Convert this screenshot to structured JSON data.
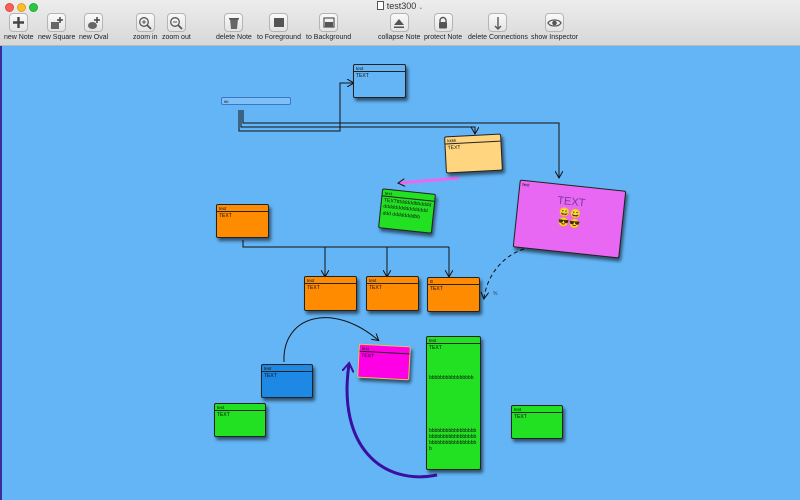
{
  "window": {
    "title": "test300",
    "doc_icon": "document-icon"
  },
  "toolbar": {
    "items": [
      {
        "label": "new Note",
        "icon": "plus-icon"
      },
      {
        "label": "new Square",
        "icon": "new-square-icon"
      },
      {
        "label": "new Oval",
        "icon": "new-oval-icon"
      },
      {
        "label": "zoom in",
        "icon": "zoom-in-icon"
      },
      {
        "label": "zoom out",
        "icon": "zoom-out-icon"
      },
      {
        "label": "delete Note",
        "icon": "trash-icon"
      },
      {
        "label": "to Foreground",
        "icon": "to-foreground-icon"
      },
      {
        "label": "to Background",
        "icon": "to-background-icon"
      },
      {
        "label": "collapse Note",
        "icon": "collapse-icon"
      },
      {
        "label": "protect Note",
        "icon": "lock-icon"
      },
      {
        "label": "delete Connections",
        "icon": "delete-connections-icon"
      },
      {
        "label": "show Inspector",
        "icon": "eye-icon"
      }
    ]
  },
  "canvas": {
    "background": "#64b5f6",
    "search_field": {
      "value": "",
      "placeholder": "tttt"
    },
    "stray_label": "%",
    "notes": {
      "top_white": {
        "title": "text",
        "body": "TEXT",
        "color": "#64b5f6"
      },
      "yellow": {
        "title": "kkkk",
        "body": "TEXT",
        "color": "#ffd580"
      },
      "green_rotated": {
        "title": "text",
        "body": "TEXTtttdddddbbdddd dddddddddddddddd ddd ddddddddbb",
        "color": "#22e022"
      },
      "pink_large": {
        "title": "text",
        "body": "TEXT",
        "color": "#e868f4",
        "emoji_top": "😀😀",
        "emoji_bottom": "😎😎"
      },
      "orange_left": {
        "title": "text",
        "body": "TEXT",
        "color": "#ff8c00"
      },
      "orange_a": {
        "title": "text",
        "body": "TEXT",
        "color": "#ff8c00"
      },
      "orange_b": {
        "title": "text",
        "body": "TEXT",
        "color": "#ff8c00"
      },
      "orange_c": {
        "title": "B",
        "body": "TEXT",
        "color": "#ff8c00"
      },
      "magenta": {
        "title": "text",
        "body": "TEXT",
        "color": "#ff00e6"
      },
      "blue": {
        "title": "text",
        "body": "TEXT",
        "color": "#1e88e5"
      },
      "green_tall": {
        "title": "text",
        "body": "TEXT",
        "color": "#22e022",
        "mid_text": "bbbbbbbbbbbbbbbb",
        "bottom_text": "bbbbbbbbbbbbbbbbbbbbbbbbbbbbbbbbbbbbbbbbbbbbbbbbbbbb"
      },
      "green_left": {
        "title": "text",
        "body": "TEXT",
        "color": "#22e022"
      },
      "green_right": {
        "title": "text",
        "body": "TEXT",
        "color": "#22e022"
      }
    }
  }
}
